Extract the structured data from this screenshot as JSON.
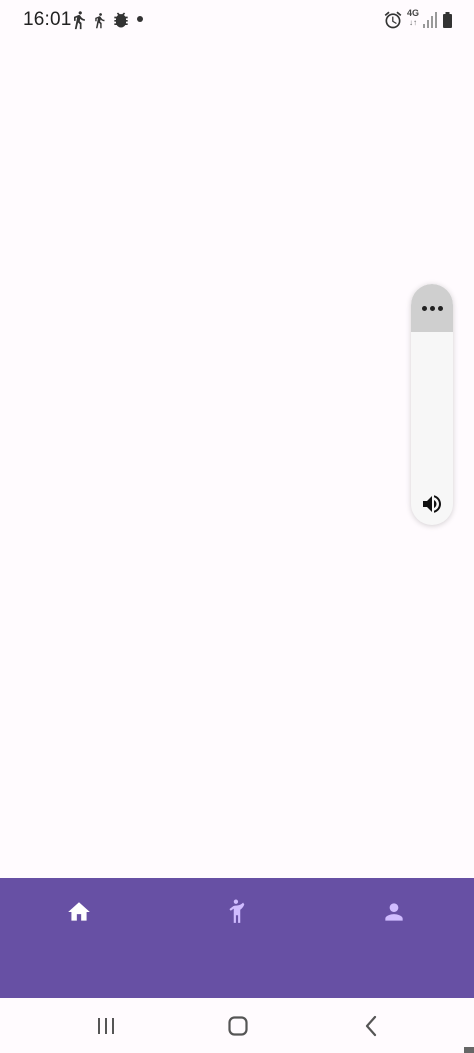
{
  "status_bar": {
    "time": "16:01",
    "network_label": "4G",
    "network_arrows": "↓↑",
    "left_icons": [
      "walking-icon",
      "walking-icon",
      "settings-bug-icon"
    ],
    "right_icons": [
      "alarm-icon",
      "signal-icon",
      "battery-icon"
    ]
  },
  "volume_panel": {
    "more_icon": "more-horiz-icon",
    "volume_icon": "volume-up-icon"
  },
  "bottom_nav": {
    "items": [
      {
        "id": "home",
        "icon": "home-icon",
        "selected": true
      },
      {
        "id": "activity",
        "icon": "person-raise-hand-icon",
        "selected": false
      },
      {
        "id": "profile",
        "icon": "person-icon",
        "selected": false
      }
    ],
    "background": "#6750a4",
    "selected_color": "#ffffff",
    "unselected_color": "#d0bcff"
  },
  "system_nav": {
    "buttons": [
      "recents-icon",
      "home-outline-icon",
      "back-icon"
    ]
  }
}
